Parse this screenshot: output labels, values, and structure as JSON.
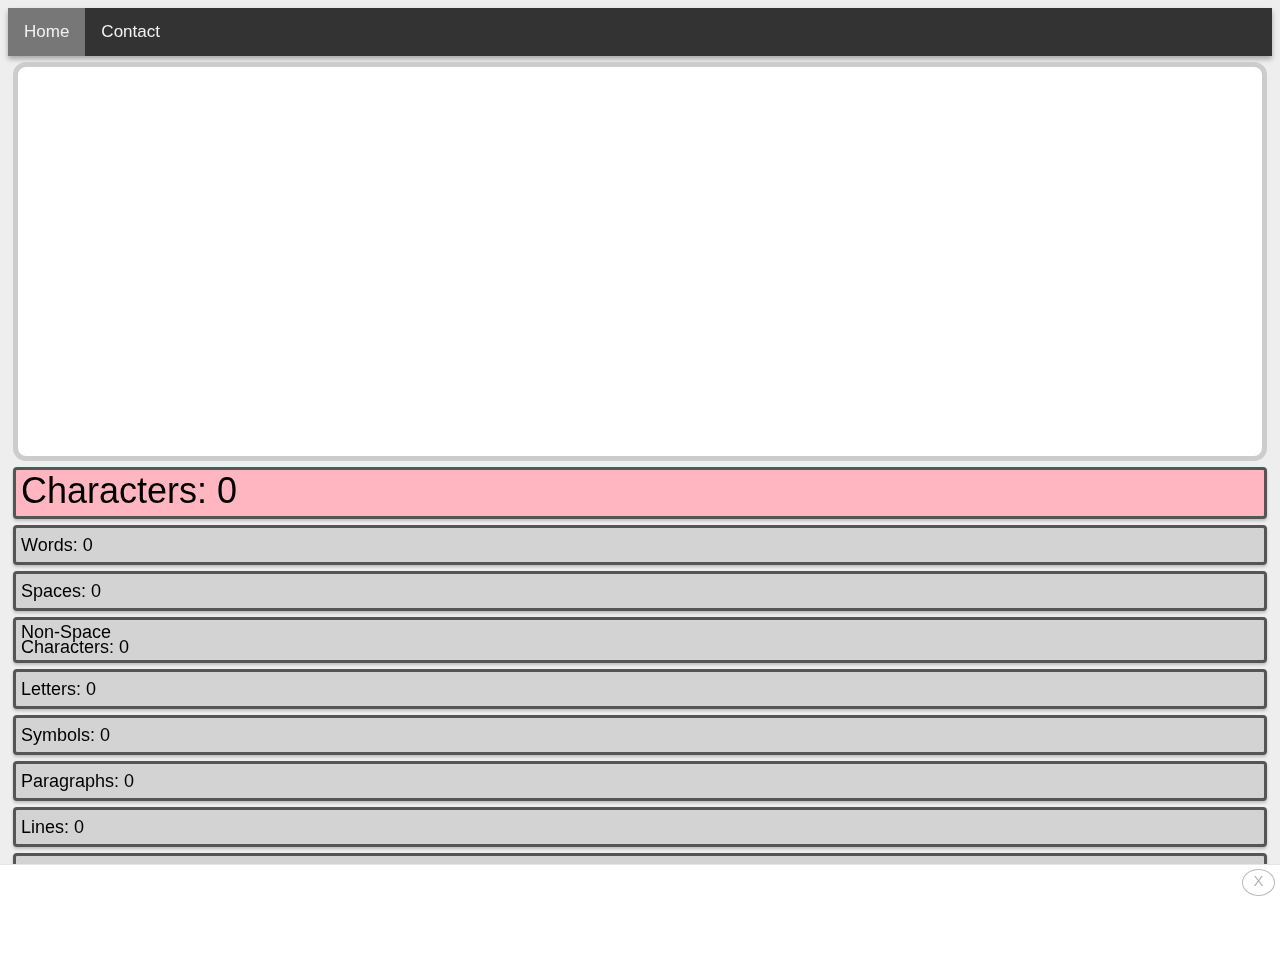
{
  "nav": {
    "items": [
      {
        "label": "Home",
        "selected": true
      },
      {
        "label": "Contact",
        "selected": false
      }
    ]
  },
  "stats": [
    {
      "kind": "primary",
      "label": "Characters: 0"
    },
    {
      "kind": "stat",
      "label": "Words: 0"
    },
    {
      "kind": "stat",
      "label": "Spaces: 0"
    },
    {
      "kind": "stat",
      "label": "Non-Space Characters: 0"
    },
    {
      "kind": "stat",
      "label": "Letters: 0"
    },
    {
      "kind": "stat",
      "label": "Symbols: 0"
    },
    {
      "kind": "stat",
      "label": "Paragraphs: 0"
    },
    {
      "kind": "stat",
      "label": "Lines: 0"
    },
    {
      "kind": "covered"
    }
  ],
  "bottom_banner": {
    "close_label": "X"
  }
}
